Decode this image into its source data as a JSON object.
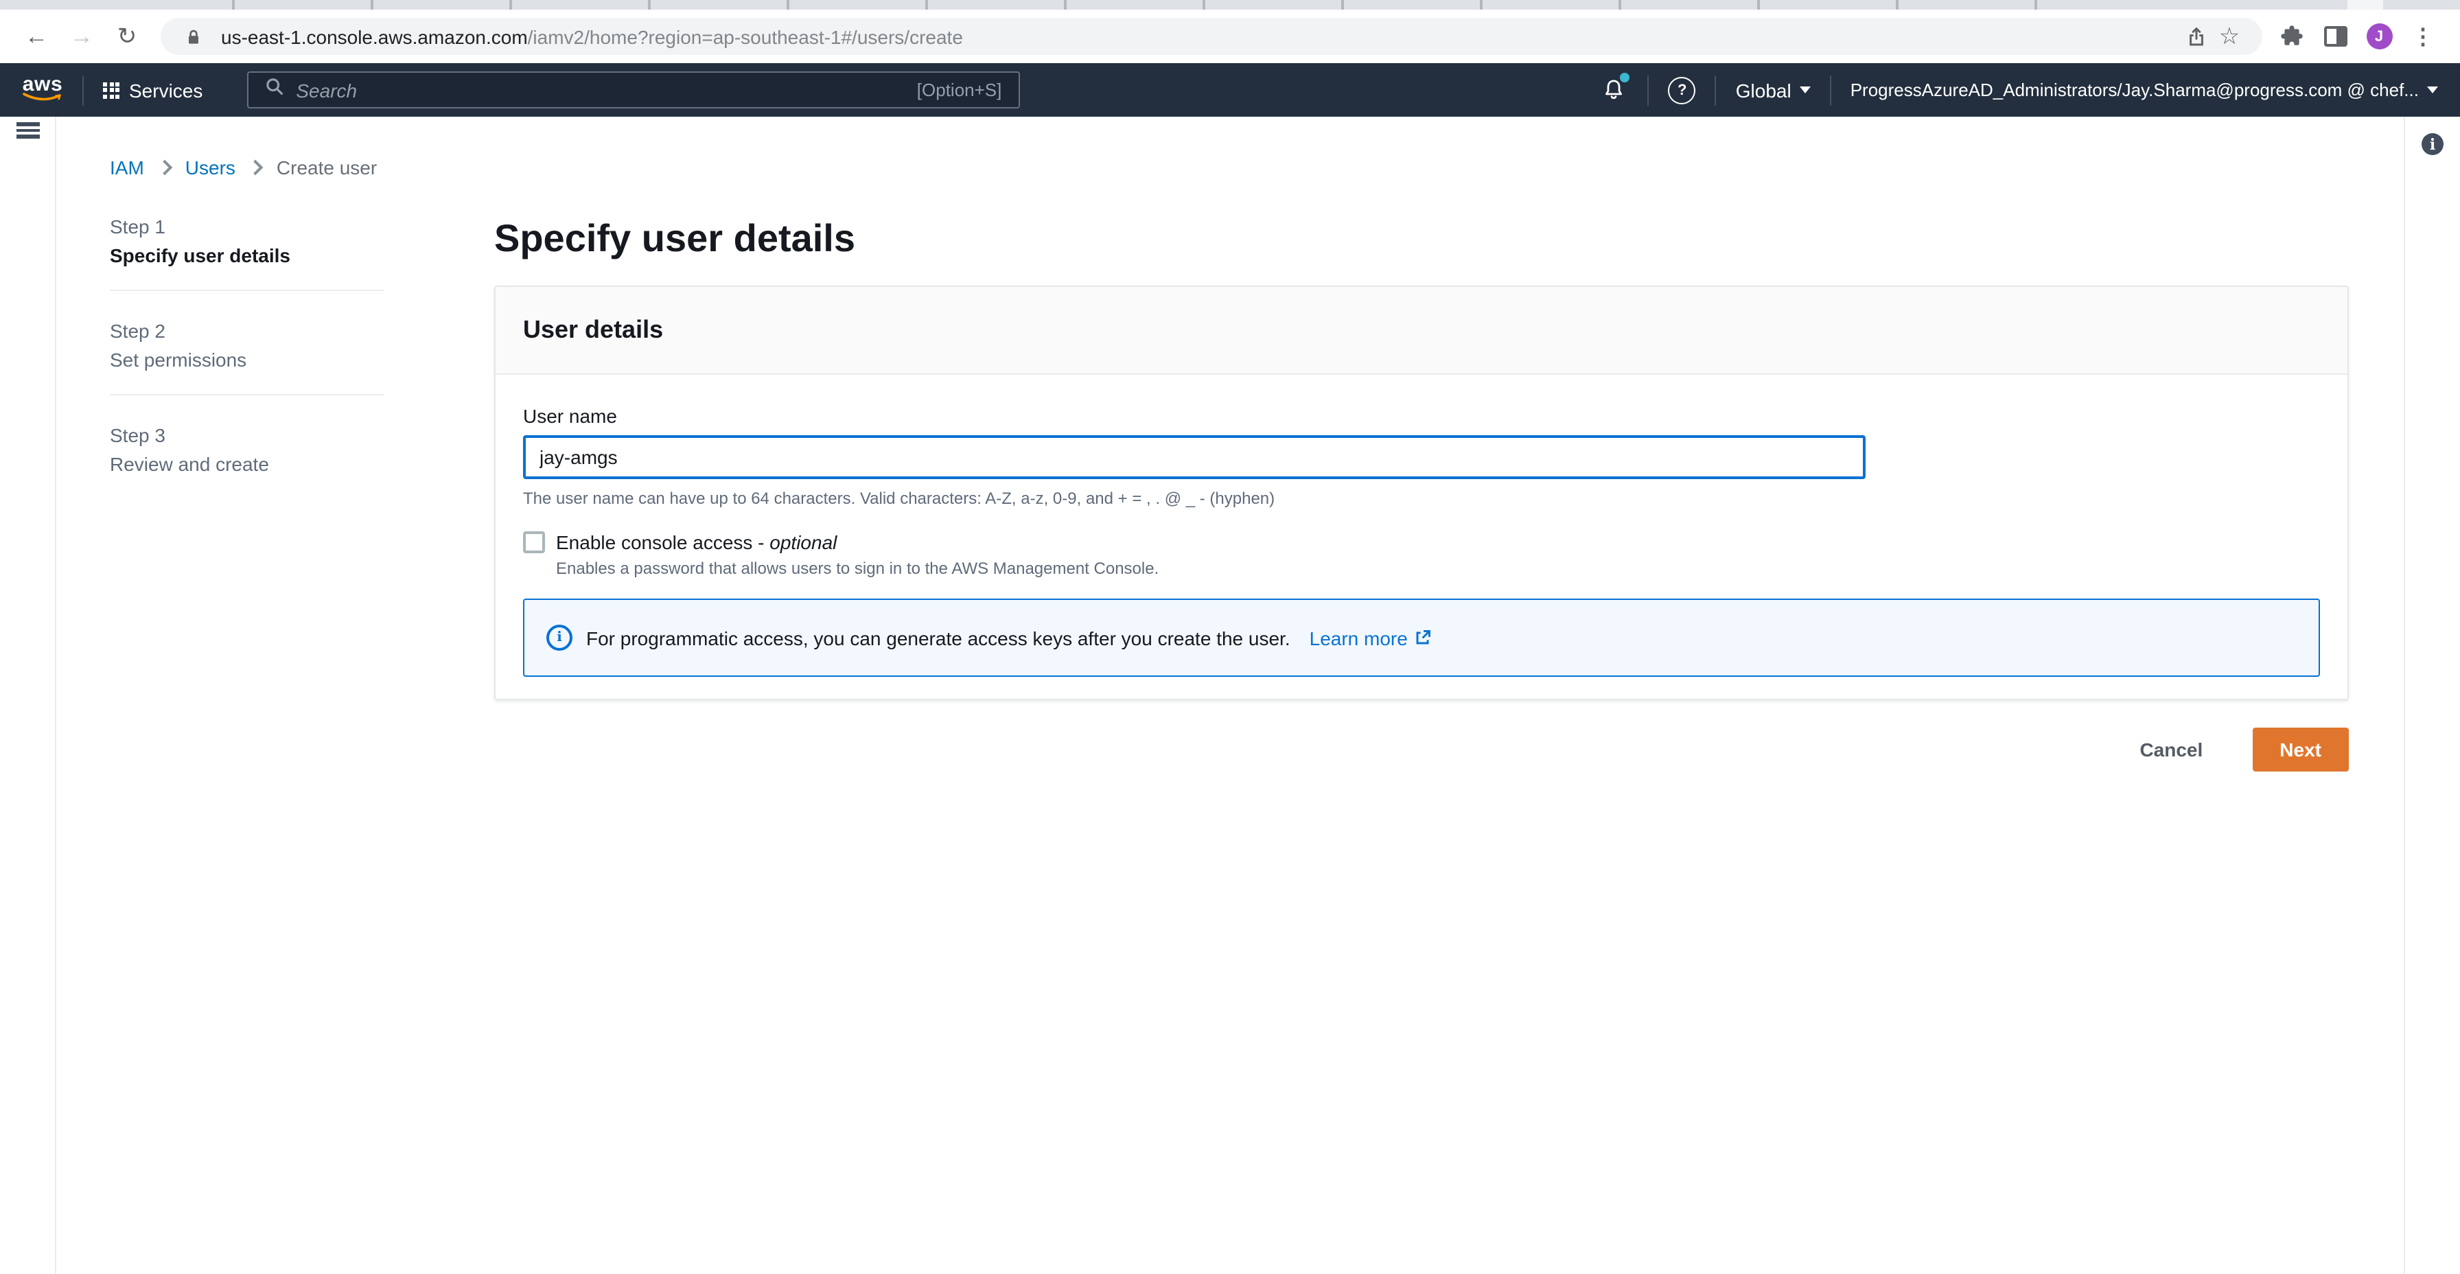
{
  "browser": {
    "url_host": "us-east-1.console.aws.amazon.com",
    "url_path": "/iamv2/home?region=ap-southeast-1#/users/create",
    "avatar_initial": "J",
    "icons": {
      "back": "←",
      "forward": "→",
      "reload": "↻",
      "star": "☆",
      "menu_dots": "⋮"
    }
  },
  "aws_nav": {
    "logo_word": "aws",
    "services_label": "Services",
    "search_placeholder": "Search",
    "search_shortcut": "[Option+S]",
    "help_glyph": "?",
    "region_label": "Global",
    "account_label": "ProgressAzureAD_Administrators/Jay.Sharma@progress.com @ chef..."
  },
  "breadcrumb": {
    "items": [
      "IAM",
      "Users",
      "Create user"
    ]
  },
  "side_info_glyph": "i",
  "steps": [
    {
      "step": "Step 1",
      "title": "Specify user details"
    },
    {
      "step": "Step 2",
      "title": "Set permissions"
    },
    {
      "step": "Step 3",
      "title": "Review and create"
    }
  ],
  "main": {
    "page_title": "Specify user details",
    "card": {
      "header": "User details",
      "username_label": "User name",
      "username_value": "jay-amgs",
      "username_help": "The user name can have up to 64 characters. Valid characters: A-Z, a-z, 0-9, and + = , . @ _ - (hyphen)",
      "console_access_label": "Enable console access - ",
      "console_access_optional": "optional",
      "console_access_desc": "Enables a password that allows users to sign in to the AWS Management Console.",
      "alert_icon_glyph": "i",
      "alert_text": "For programmatic access, you can generate access keys after you create the user.",
      "alert_link": "Learn more"
    },
    "footer": {
      "cancel": "Cancel",
      "next": "Next"
    }
  },
  "colors": {
    "nav_bg": "#232f3e",
    "accent_blue": "#0972d3",
    "link_blue": "#0073bb",
    "primary_btn": "#e0762e",
    "alert_bg": "#f2f8fd",
    "notification_dot": "#3cb9d1",
    "avatar_purple": "#a04cc9",
    "aws_smile_orange": "#ff9900"
  }
}
